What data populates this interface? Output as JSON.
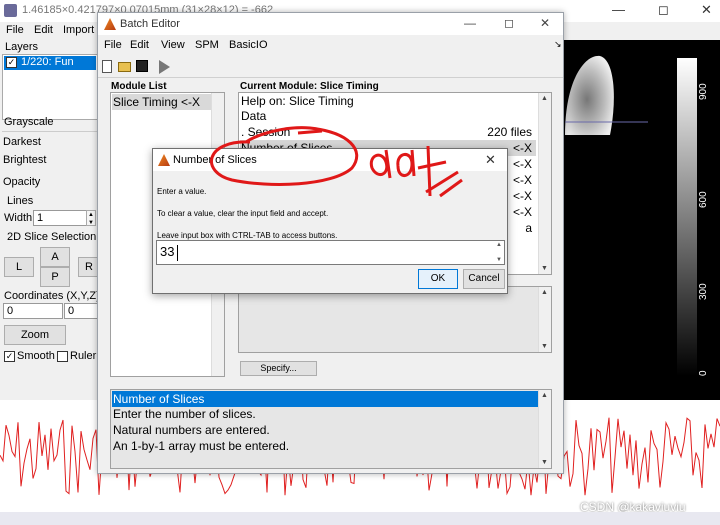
{
  "mgl": {
    "title": "1.46185×0.421797×0.07015mm (31×28×12) = -662",
    "menu": [
      "File",
      "Edit",
      "Import"
    ],
    "layers_label": "Layers",
    "layer_item": "1/220: Fun",
    "colormap": "Grayscale",
    "darkest": "Darkest",
    "brightest": "Brightest",
    "opacity": "Opacity",
    "lines": "Lines",
    "width_label": "Width",
    "width_value": "1",
    "slice_section": "2D Slice Selection",
    "btn_a": "A",
    "btn_l": "L",
    "btn_p": "P",
    "btn_r": "R",
    "coords_label": "Coordinates (X,Y,Z)",
    "coord_x": "0",
    "coord_y": "0",
    "zoom": "Zoom",
    "smooth": "Smooth",
    "ruler": "Ruler",
    "colorbar_ticks": [
      "900",
      "600",
      "300",
      "0"
    ],
    "watermark": "CSDN @kakaviuviu"
  },
  "batch": {
    "title": "Batch Editor",
    "menu": [
      "File",
      "Edit",
      "View",
      "SPM",
      "BasicIO"
    ],
    "module_list_label": "Module List",
    "module_item": "Slice Timing <-X",
    "current_module_label": "Current Module: Slice Timing",
    "rows": [
      {
        "label": "Help on: Slice Timing",
        "value": ""
      },
      {
        "label": "Data",
        "value": ""
      },
      {
        "label": ". Session",
        "value": "220 files"
      },
      {
        "label": "Number of Slices",
        "value": "<-X"
      },
      {
        "label": "",
        "value": "<-X"
      },
      {
        "label": "",
        "value": "<-X"
      },
      {
        "label": "",
        "value": "<-X"
      },
      {
        "label": "",
        "value": "<-X"
      },
      {
        "label": "",
        "value": "a"
      }
    ],
    "specify": "Specify...",
    "help_lines": [
      "Number of Slices",
      "Enter the number of slices.",
      "Natural numbers are entered.",
      "An 1-by-1 array must be entered."
    ]
  },
  "dialog": {
    "title": "Number of Slices",
    "line1": "Enter a value.",
    "line2": "To clear a value, clear the input field and accept.",
    "line3": "Leave input box with CTRL-TAB to access buttons.",
    "value": "33",
    "ok": "OK",
    "cancel": "Cancel"
  },
  "colors": {
    "selection": "#0078d7",
    "annotation": "#e01818",
    "signal": "#e02020"
  }
}
